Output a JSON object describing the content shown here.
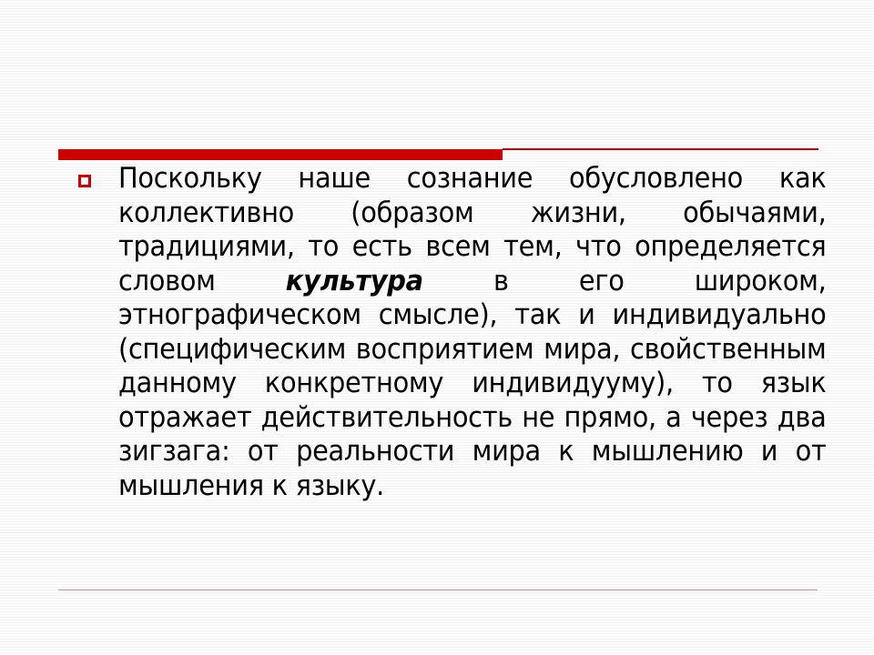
{
  "slide": {
    "accent_color": "#cc0000",
    "bullet_icon": "hollow-square-bullet",
    "paragraph": {
      "before": "Поскольку наше сознание обусловлено как коллективно (образом жизни, обычаями, традициями, то есть всем тем, что определяется словом ",
      "emphasis": "культура",
      "after": " в его широком, этнографическом смысле), так и индивидуально (специфическим восприятием мира, свойственным данному конкретному индивидууму), то язык отражает действительность не прямо, а через два зигзага: от реальности мира к мышлению и от мышления к языку."
    }
  }
}
